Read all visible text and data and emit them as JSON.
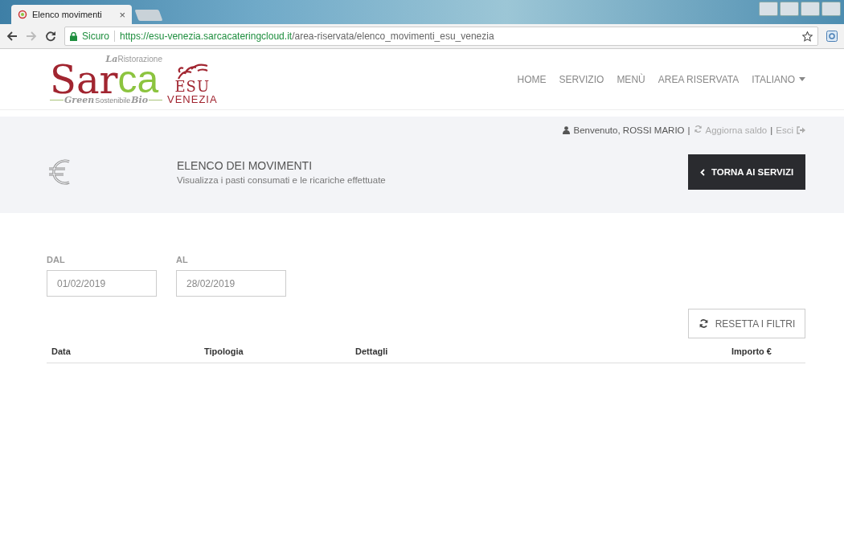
{
  "browser": {
    "tab_title": "Elenco movimenti",
    "tab_close": "×",
    "secure_label": "Sicuro",
    "url_host": "https://esu-venezia.sarcacateringcloud.it",
    "url_path": "/area-riservata/elenco_movimenti_esu_venezia"
  },
  "logo": {
    "script_prefix": "La",
    "subtitle": "Ristorazione",
    "brand_red": "Sar",
    "brand_green": "ca",
    "tag_green": "Green",
    "tag_middle": "Sostenibile",
    "tag_bio": "Bio",
    "partner_letters": "ESU",
    "partner_city": "VENEZIA"
  },
  "nav": [
    {
      "label": "HOME",
      "kind": "link"
    },
    {
      "label": "SERVIZIO",
      "kind": "link"
    },
    {
      "label": "MENÙ",
      "kind": "link"
    },
    {
      "label": "AREA RISERVATA",
      "kind": "link"
    },
    {
      "label": "ITALIANO",
      "kind": "dropdown"
    }
  ],
  "user_bar": {
    "welcome": "Benvenuto, ROSSI MARIO",
    "separator_1": "|",
    "refresh": "Aggiorna saldo",
    "separator_2": "|",
    "logout": "Esci"
  },
  "page_header": {
    "title": "ELENCO DEI MOVIMENTI",
    "subtitle": "Visualizza i pasti consumati e le ricariche effettuate",
    "back_button": "TORNA AI SERVIZI"
  },
  "filters": [
    {
      "label": "DAL",
      "value": "01/02/2019"
    },
    {
      "label": "AL",
      "value": "28/02/2019"
    }
  ],
  "reset_button": "RESETTA I FILTRI",
  "table": {
    "columns": [
      {
        "label": "Data"
      },
      {
        "label": "Tipologia"
      },
      {
        "label": "Dettagli"
      },
      {
        "label": "Importo €"
      }
    ]
  }
}
